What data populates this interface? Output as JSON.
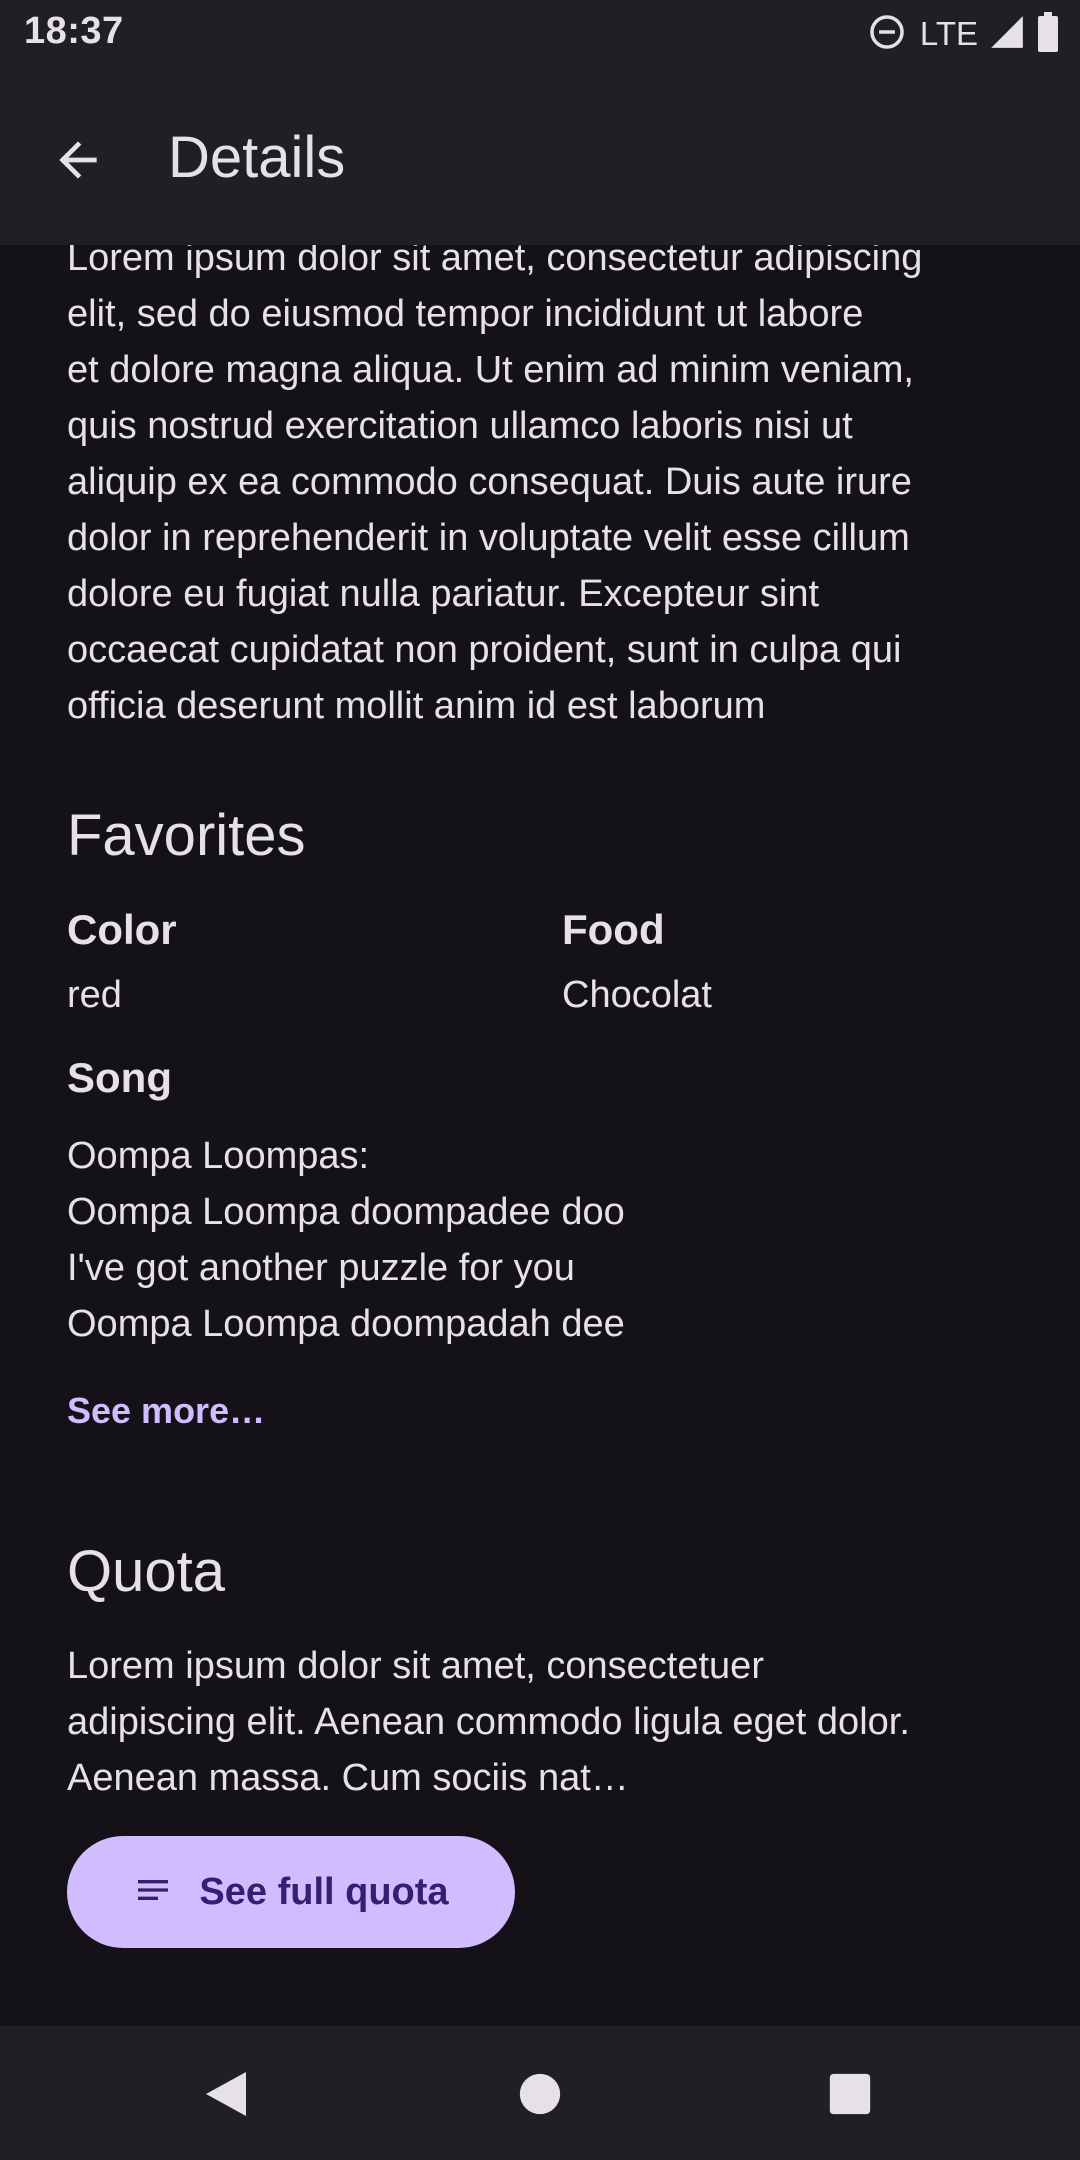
{
  "status_bar": {
    "time": "18:37",
    "network": "LTE",
    "icons": [
      "do-not-disturb-icon",
      "signal-icon",
      "battery-icon"
    ]
  },
  "app_bar": {
    "title": "Details",
    "back_icon": "arrow-back-icon"
  },
  "content": {
    "description_lines": [
      "Lorem ipsum dolor sit amet, consectetur adipiscing",
      "elit, sed do eiusmod tempor incididunt ut labore",
      "et dolore magna aliqua. Ut enim ad minim veniam,",
      "quis nostrud exercitation ullamco laboris nisi ut",
      "aliquip ex ea commodo consequat. Duis aute irure",
      "dolor in reprehenderit in voluptate velit esse cillum",
      "dolore eu fugiat nulla pariatur. Excepteur sint",
      "occaecat cupidatat non proident, sunt in culpa qui",
      "officia deserunt mollit anim id est laborum"
    ],
    "favorites": {
      "title": "Favorites",
      "color_label": "Color",
      "color_value": "red",
      "food_label": "Food",
      "food_value": "Chocolat",
      "song_label": "Song",
      "song_lines": [
        "Oompa Loompas:",
        "Oompa Loompa doompadee doo",
        "I've got another puzzle for you",
        "Oompa Loompa doompadah dee"
      ],
      "see_more": "See more…"
    },
    "quota": {
      "title": "Quota",
      "text_lines": [
        "Lorem ipsum dolor sit amet, consectetuer",
        "adipiscing elit. Aenean commodo ligula eget dolor.",
        "Aenean massa. Cum sociis nat…"
      ],
      "button_label": "See full quota",
      "button_icon": "notes-icon"
    }
  },
  "nav_bar": {
    "icons": [
      "nav-back-icon",
      "nav-home-icon",
      "nav-recents-icon"
    ]
  },
  "colors": {
    "background": "#141218",
    "surface": "#211f26",
    "on_surface": "#e6e0e9",
    "primary": "#d0bcff",
    "on_primary": "#381e72"
  }
}
